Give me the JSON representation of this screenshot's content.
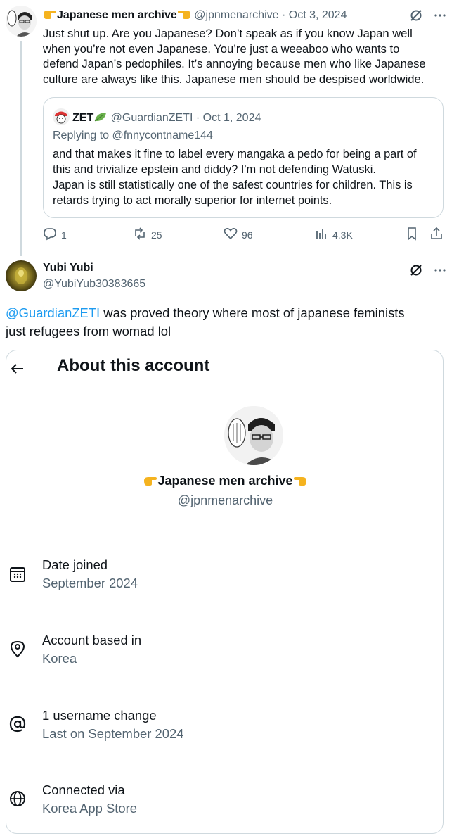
{
  "tweet1": {
    "display_name": "Japanese men archive",
    "handle": "@jpnmenarchive",
    "sep": "·",
    "date": "Oct 3, 2024",
    "lines": [
      "Just shut up. Are you Japanese? Don’t speak as if you know Japan well",
      "when you’re not even Japanese. You’re just a weeaboo who wants to",
      "defend Japan’s pedophiles. It’s annoying because men who like Japanese",
      "culture are always like this. Japanese men should be despised worldwide."
    ],
    "quote": {
      "display_name": "ZET",
      "handle": "@GuardianZETI",
      "sep": "·",
      "date": "Oct 1, 2024",
      "replying_to": "Replying to @fnnycontname144",
      "lines": [
        "and that makes it fine to label every mangaka a pedo for being a part of",
        "this and trivialize epstein and diddy? I'm not defending Watuski.",
        "Japan is still statistically one of the safest countries for children. This is",
        "retards trying to act morally superior for internet points."
      ]
    },
    "stats": {
      "replies": "1",
      "reposts": "25",
      "likes": "96",
      "views": "4.3K"
    }
  },
  "tweet2": {
    "display_name": "Yubi Yubi",
    "handle": "@YubiYub30383665",
    "mention": "@GuardianZETI",
    "line1_rest": " was proved theory where most of japanese feminists",
    "line2": "just refugees from womad lol"
  },
  "about": {
    "title": "About this account",
    "display_name": "Japanese men archive",
    "handle": "@jpnmenarchive",
    "rows": [
      {
        "icon": "calendar-icon",
        "title": "Date joined",
        "value": "September 2024"
      },
      {
        "icon": "location-pin-icon",
        "title": "Account based in",
        "value": "Korea"
      },
      {
        "icon": "at-sign-icon",
        "title": "1 username change",
        "value": "Last on September 2024"
      },
      {
        "icon": "globe-icon",
        "title": "Connected via",
        "value": "Korea App Store"
      }
    ]
  },
  "colors": {
    "text": "#0f1419",
    "muted": "#536471",
    "link": "#1d9bf0",
    "border": "#cfd9de"
  }
}
